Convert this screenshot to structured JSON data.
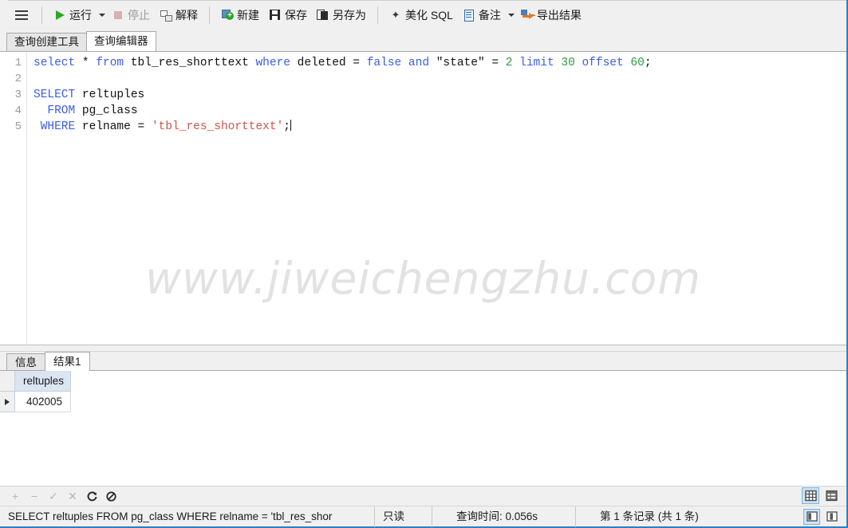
{
  "toolbar": {
    "menu_icon": "hamburger-icon",
    "buttons": [
      {
        "id": "run",
        "label": "运行",
        "icon": "play-icon",
        "disabled": false,
        "has_caret": true
      },
      {
        "id": "stop",
        "label": "停止",
        "icon": "stop-icon",
        "disabled": true,
        "has_caret": false
      },
      {
        "id": "explain",
        "label": "解释",
        "icon": "explain-icon",
        "disabled": false,
        "has_caret": false
      },
      {
        "id": "new",
        "label": "新建",
        "icon": "new-file-icon",
        "disabled": false,
        "has_caret": false
      },
      {
        "id": "save",
        "label": "保存",
        "icon": "floppy-icon",
        "disabled": false,
        "has_caret": false
      },
      {
        "id": "save_as",
        "label": "另存为",
        "icon": "save-as-icon",
        "disabled": false,
        "has_caret": false
      },
      {
        "id": "beautify",
        "label": "美化 SQL",
        "icon": "magic-wand-icon",
        "disabled": false,
        "has_caret": false
      },
      {
        "id": "note",
        "label": "备注",
        "icon": "note-icon",
        "disabled": false,
        "has_caret": true
      },
      {
        "id": "export",
        "label": "导出结果",
        "icon": "export-icon",
        "disabled": false,
        "has_caret": false
      }
    ]
  },
  "tabs": [
    {
      "label": "查询创建工具",
      "active": false
    },
    {
      "label": "查询编辑器",
      "active": true
    }
  ],
  "editor": {
    "watermark": "www.jiweichengzhu.com",
    "line_numbers": [
      "1",
      "2",
      "3",
      "4",
      "5"
    ],
    "lines": [
      [
        {
          "t": "select",
          "c": "kw"
        },
        {
          "t": " * ",
          "c": "plain"
        },
        {
          "t": "from",
          "c": "kw"
        },
        {
          "t": " tbl_res_shorttext ",
          "c": "plain"
        },
        {
          "t": "where",
          "c": "kw"
        },
        {
          "t": " deleted = ",
          "c": "plain"
        },
        {
          "t": "false",
          "c": "kw"
        },
        {
          "t": " ",
          "c": "plain"
        },
        {
          "t": "and",
          "c": "kw"
        },
        {
          "t": " \"state\" = ",
          "c": "plain"
        },
        {
          "t": "2",
          "c": "num"
        },
        {
          "t": " ",
          "c": "plain"
        },
        {
          "t": "limit",
          "c": "kw"
        },
        {
          "t": " ",
          "c": "plain"
        },
        {
          "t": "30",
          "c": "num"
        },
        {
          "t": " ",
          "c": "plain"
        },
        {
          "t": "offset",
          "c": "kw"
        },
        {
          "t": " ",
          "c": "plain"
        },
        {
          "t": "60",
          "c": "num"
        },
        {
          "t": ";",
          "c": "plain"
        }
      ],
      [],
      [
        {
          "t": "SELECT",
          "c": "kw"
        },
        {
          "t": " reltuples",
          "c": "plain"
        }
      ],
      [
        {
          "t": "  FROM",
          "c": "kw"
        },
        {
          "t": " pg_class",
          "c": "plain"
        }
      ],
      [
        {
          "t": " WHERE",
          "c": "kw"
        },
        {
          "t": " relname = ",
          "c": "plain"
        },
        {
          "t": "'tbl_res_shorttext'",
          "c": "str"
        },
        {
          "t": ";",
          "c": "plain"
        }
      ]
    ]
  },
  "results": {
    "tabs": [
      {
        "label": "信息",
        "active": false
      },
      {
        "label": "结果1",
        "active": true
      }
    ],
    "columns": [
      "reltuples"
    ],
    "rows": [
      {
        "marker": "▶",
        "cells": [
          "402005"
        ]
      }
    ]
  },
  "grid_toolbar": {
    "buttons": [
      {
        "id": "add",
        "glyph": "+",
        "icon": "plus-icon",
        "dim": true
      },
      {
        "id": "remove",
        "glyph": "−",
        "icon": "minus-icon",
        "dim": true
      },
      {
        "id": "apply",
        "glyph": "✓",
        "icon": "check-icon",
        "dim": true
      },
      {
        "id": "cancel",
        "glyph": "✕",
        "icon": "cross-icon",
        "dim": true
      },
      {
        "id": "refresh",
        "glyph": "⟳",
        "icon": "refresh-icon",
        "dim": false
      },
      {
        "id": "stop",
        "glyph": "🚫",
        "icon": "no-entry-icon",
        "dim": false
      }
    ],
    "views": [
      {
        "id": "grid_view",
        "icon": "grid-view-icon",
        "selected": true
      },
      {
        "id": "form_view",
        "icon": "form-view-icon",
        "selected": false
      }
    ]
  },
  "statusbar": {
    "sql": "SELECT reltuples  FROM pg_class  WHERE relname = 'tbl_res_shor",
    "readonly": "只读",
    "query_time": "查询时间: 0.056s",
    "record_count": "第 1 条记录 (共 1 条)",
    "panel_toggles": [
      {
        "id": "left_panel",
        "icon": "panel-left-icon",
        "selected": true
      },
      {
        "id": "right_panel",
        "icon": "panel-right-icon",
        "selected": false
      }
    ]
  },
  "colors": {
    "accent": "#2f7fc4",
    "keyword": "#3c5ce8",
    "number": "#2e9b3e",
    "string": "#d2544a",
    "header_bg": "#dbe5f1",
    "chrome": "#f0f0f0"
  }
}
